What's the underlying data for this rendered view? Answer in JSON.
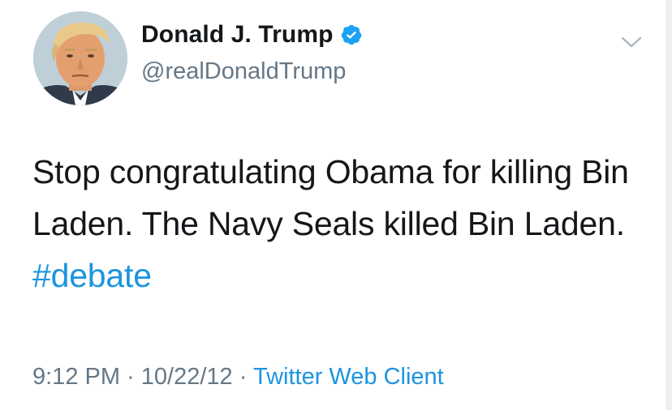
{
  "author": {
    "display_name": "Donald J. Trump",
    "handle": "@realDonaldTrump",
    "verified": true,
    "verified_color": "#1da1f2"
  },
  "tweet": {
    "text_before": "Stop congratulating Obama for killing Bin Laden. The Navy Seals killed Bin Laden. ",
    "hashtag": "#debate"
  },
  "meta": {
    "time": "9:12 PM",
    "separator": "·",
    "date": "10/22/12",
    "source": "Twitter Web Client"
  },
  "icons": {
    "verified": "verified-badge-icon",
    "menu": "chevron-down-icon"
  },
  "colors": {
    "text": "#14171a",
    "secondary": "#657786",
    "link": "#1b95e0"
  }
}
